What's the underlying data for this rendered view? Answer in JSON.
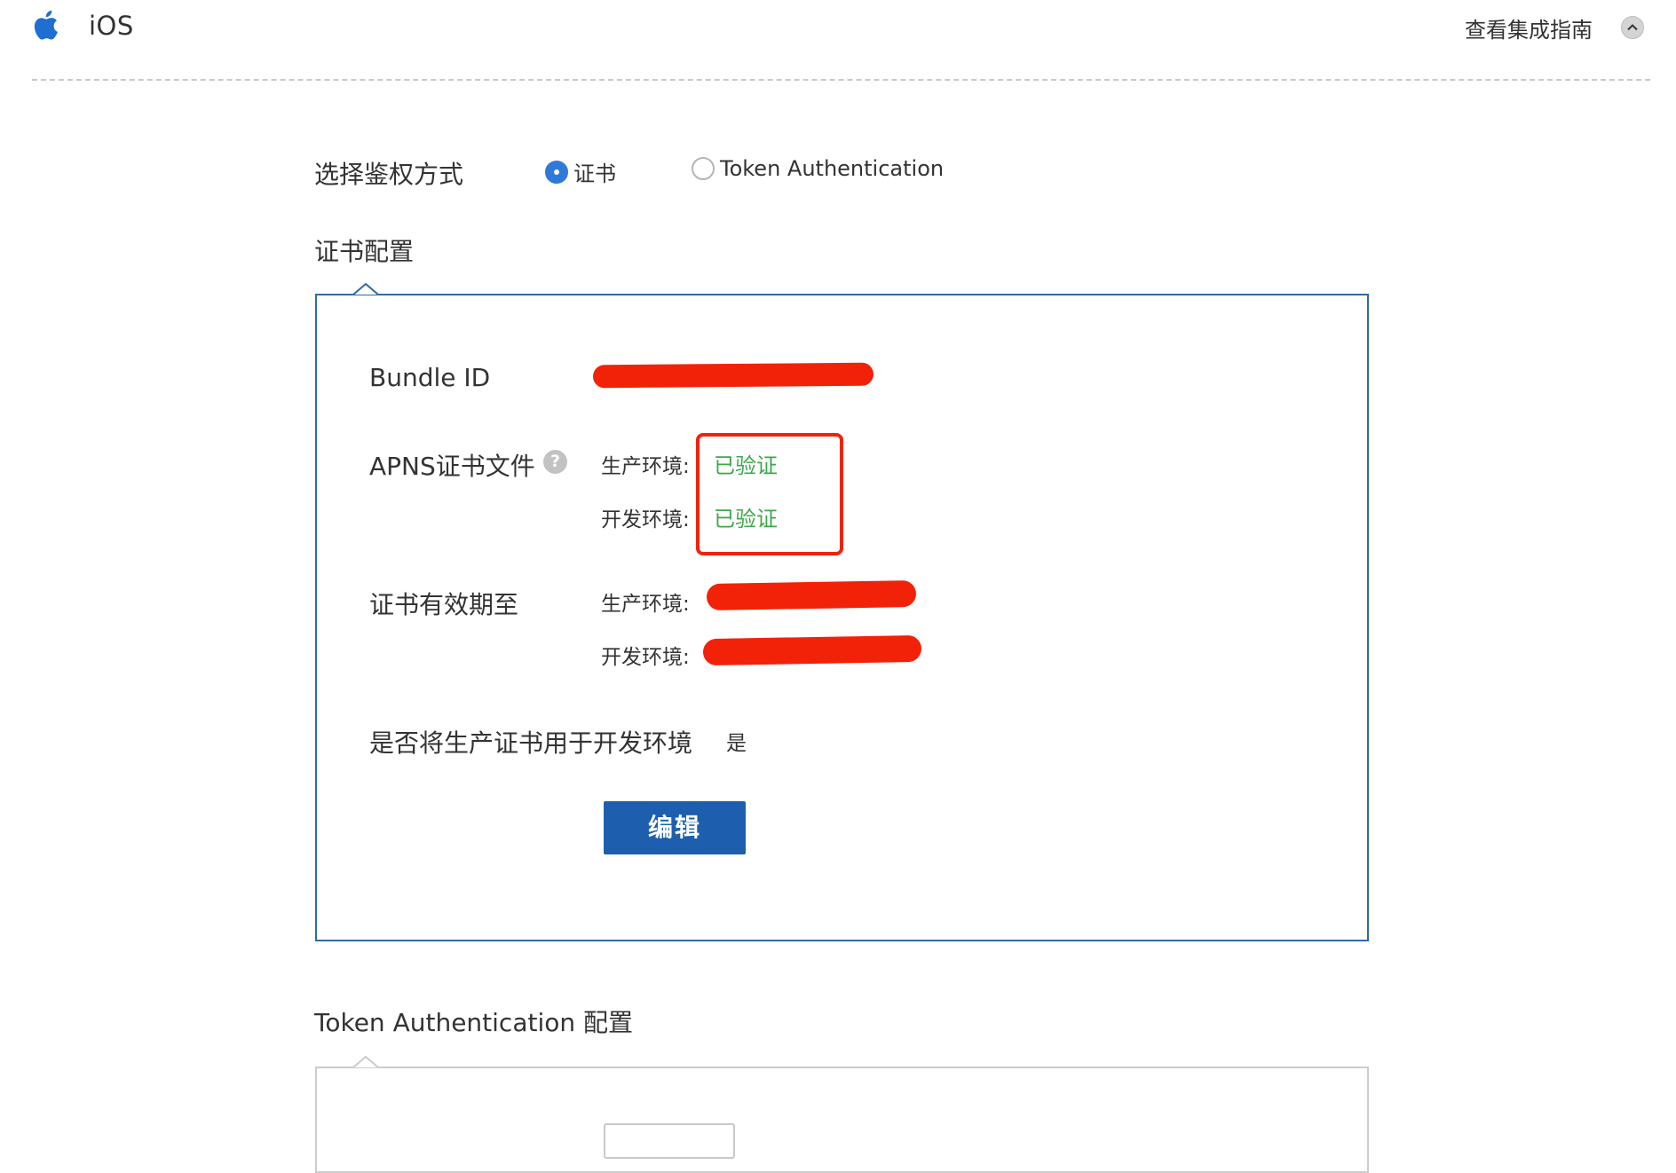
{
  "header": {
    "platform_icon": "apple-icon",
    "title": "iOS",
    "guide_link": "查看集成指南",
    "collapse_icon": "chevron-up-icon"
  },
  "auth": {
    "label": "选择鉴权方式",
    "options": [
      {
        "label": "证书",
        "selected": true
      },
      {
        "label": "Token Authentication",
        "selected": false
      }
    ]
  },
  "certificate_config": {
    "title": "证书配置",
    "bundle_id_label": "Bundle ID",
    "apns_label": "APNS证书文件",
    "help_icon": "question-mark-icon",
    "apns_rows": [
      {
        "env": "生产环境:",
        "status": "已验证"
      },
      {
        "env": "开发环境:",
        "status": "已验证"
      }
    ],
    "expiry_label": "证书有效期至",
    "expiry_rows": [
      {
        "env": "生产环境:"
      },
      {
        "env": "开发环境:"
      }
    ],
    "use_prod_label": "是否将生产证书用于开发环境",
    "use_prod_value": "是",
    "edit_button": "编辑"
  },
  "token_config": {
    "title": "Token Authentication 配置"
  },
  "colors": {
    "accent_blue": "#1d5fae",
    "radio_blue": "#2f7ad9",
    "verified_green": "#3da84b",
    "highlight_red": "#f22208"
  }
}
